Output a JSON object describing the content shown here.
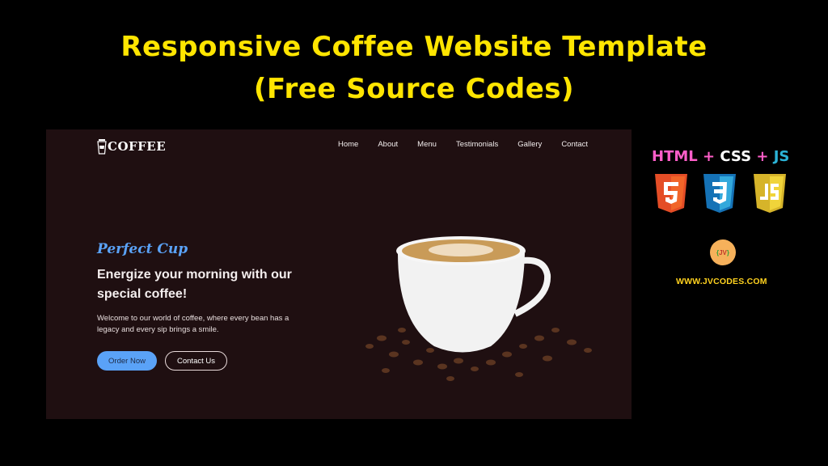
{
  "banner": {
    "title_line1": "Responsive Coffee Website Template",
    "title_line2": "(Free Source Codes)",
    "title_color": "#ffe500"
  },
  "site": {
    "background": "#1f0f11",
    "logo": {
      "icon": "coffee-cup-icon",
      "text": "COFFEE"
    },
    "nav": [
      "Home",
      "About",
      "Menu",
      "Testimonials",
      "Gallery",
      "Contact"
    ],
    "hero": {
      "tagline": "Perfect Cup",
      "headline": "Energize your morning with our special coffee!",
      "description": "Welcome to our world of coffee, where every bean has a legacy and every sip brings a smile.",
      "buttons": {
        "primary": "Order Now",
        "secondary": "Contact Us"
      },
      "image": "coffee-cup-with-beans",
      "accent": "#5aa2f7"
    }
  },
  "sidebar": {
    "stack": {
      "html": "HTML",
      "plus1": "+",
      "css": "CSS",
      "plus2": "+",
      "js": "JS"
    },
    "badges": [
      {
        "icon": "html5-icon",
        "label": "5",
        "color": "#e44d26"
      },
      {
        "icon": "css3-icon",
        "label": "3",
        "color": "#2196f3"
      },
      {
        "icon": "js-icon",
        "label": "JS",
        "color": "#e5c12b"
      }
    ],
    "brand_logo": {
      "text": "{JV}"
    },
    "url": "WWW.JVCODES.COM"
  }
}
